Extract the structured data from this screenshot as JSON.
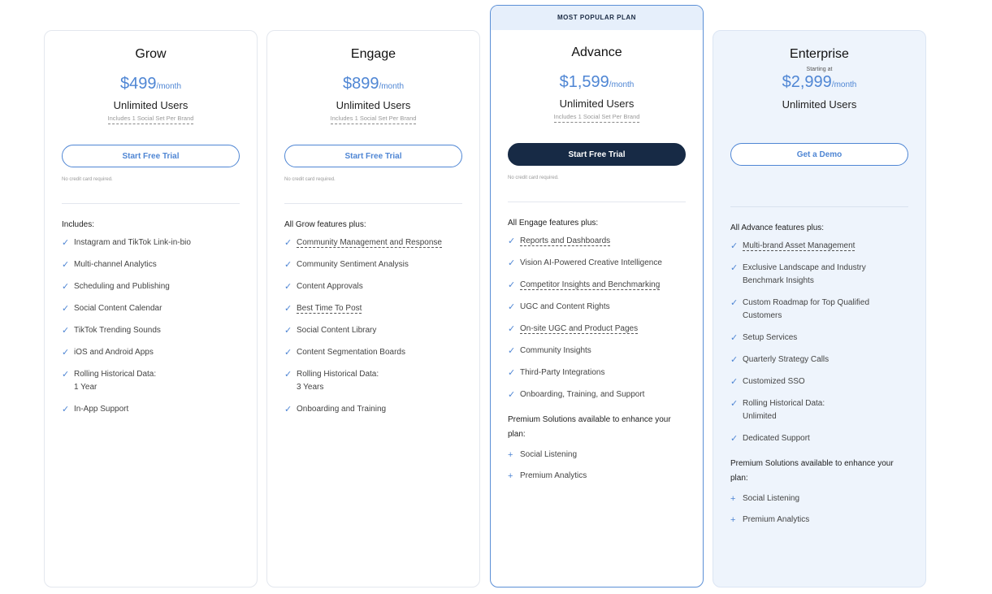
{
  "accent": "#4f86d4",
  "dark_button": "#172a45",
  "plans": [
    {
      "name": "Grow",
      "price": "$499",
      "per": "/month",
      "users": "Unlimited Users",
      "social": "Includes 1 Social Set Per Brand",
      "cta": "Start Free Trial",
      "no_cc": "No credit card required.",
      "section": "Includes:",
      "features": [
        {
          "text": "Instagram and TikTok Link-in-bio"
        },
        {
          "text": "Multi-channel Analytics"
        },
        {
          "text": "Scheduling and Publishing"
        },
        {
          "text": "Social Content Calendar"
        },
        {
          "text": "TikTok Trending Sounds"
        },
        {
          "text": "iOS and Android Apps"
        },
        {
          "text": "Rolling Historical Data:",
          "sub": "1 Year"
        },
        {
          "text": "In-App Support"
        }
      ]
    },
    {
      "name": "Engage",
      "price": "$899",
      "per": "/month",
      "users": "Unlimited Users",
      "social": "Includes 1 Social Set Per Brand",
      "cta": "Start Free Trial",
      "no_cc": "No credit card required.",
      "section": "All Grow features plus:",
      "features": [
        {
          "text": "Community Management and Response",
          "underline": true
        },
        {
          "text": "Community Sentiment Analysis"
        },
        {
          "text": "Content Approvals"
        },
        {
          "text": "Best Time To Post",
          "underline": true
        },
        {
          "text": "Social Content Library"
        },
        {
          "text": "Content Segmentation Boards"
        },
        {
          "text": "Rolling Historical Data:",
          "sub": "3 Years"
        },
        {
          "text": "Onboarding and Training"
        }
      ]
    },
    {
      "badge": "MOST POPULAR PLAN",
      "name": "Advance",
      "price": "$1,599",
      "per": "/month",
      "users": "Unlimited Users",
      "social": "Includes 1 Social Set Per Brand",
      "cta": "Start Free Trial",
      "no_cc": "No credit card required.",
      "section": "All Engage features plus:",
      "features": [
        {
          "text": "Reports and Dashboards",
          "underline": true
        },
        {
          "text": "Vision AI-Powered Creative Intelligence"
        },
        {
          "text": "Competitor Insights and Benchmarking",
          "underline": true
        },
        {
          "text": "UGC and Content Rights"
        },
        {
          "text": "On-site UGC and Product Pages",
          "underline": true
        },
        {
          "text": "Community Insights"
        },
        {
          "text": "Third-Party Integrations"
        },
        {
          "text": "Onboarding, Training, and Support"
        }
      ],
      "premium": "Premium Solutions available to enhance your plan:",
      "addons": [
        "Social Listening",
        "Premium Analytics"
      ]
    },
    {
      "name": "Enterprise",
      "starting": "Starting at",
      "price": "$2,999",
      "per": "/month",
      "users": "Unlimited Users",
      "cta": "Get a Demo",
      "section": "All Advance features plus:",
      "features": [
        {
          "text": "Multi-brand Asset Management",
          "underline": true
        },
        {
          "text": "Exclusive Landscape and Industry",
          "sub": "Benchmark Insights"
        },
        {
          "text": "Custom Roadmap for Top Qualified",
          "sub": "Customers"
        },
        {
          "text": "Setup Services"
        },
        {
          "text": "Quarterly Strategy Calls"
        },
        {
          "text": "Customized SSO"
        },
        {
          "text": "Rolling Historical Data:",
          "sub": "Unlimited"
        },
        {
          "text": "Dedicated Support"
        }
      ],
      "premium": "Premium Solutions available to enhance your plan:",
      "addons": [
        "Social Listening",
        "Premium Analytics"
      ]
    }
  ]
}
